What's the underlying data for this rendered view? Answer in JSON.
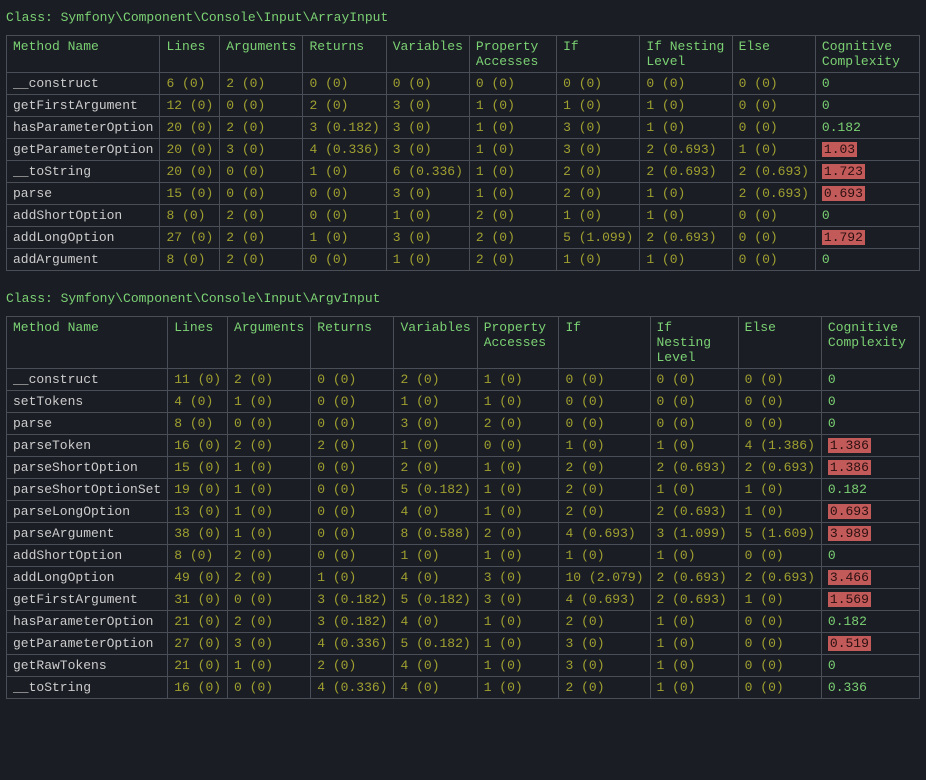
{
  "columns": [
    "Method Name",
    "Lines",
    "Arguments",
    "Returns",
    "Variables",
    "Property Accesses",
    "If",
    "If Nesting Level",
    "Else",
    "Cognitive Complexity"
  ],
  "tables": [
    {
      "title_prefix": "Class: ",
      "title_class": "Symfony\\Component\\Console\\Input\\ArrayInput",
      "rows": [
        {
          "name": "__construct",
          "lines": "6 (0)",
          "args": "2 (0)",
          "ret": "0 (0)",
          "vars": "0 (0)",
          "prop": "0 (0)",
          "if": "0 (0)",
          "nest": "0 (0)",
          "else": "0 (0)",
          "cc": "0",
          "cc_hl": false,
          "cc_green": true
        },
        {
          "name": "getFirstArgument",
          "lines": "12 (0)",
          "args": "0 (0)",
          "ret": "2 (0)",
          "vars": "3 (0)",
          "prop": "1 (0)",
          "if": "1 (0)",
          "nest": "1 (0)",
          "else": "0 (0)",
          "cc": "0",
          "cc_hl": false,
          "cc_green": true
        },
        {
          "name": "hasParameterOption",
          "lines": "20 (0)",
          "args": "2 (0)",
          "ret": "3 (0.182)",
          "vars": "3 (0)",
          "prop": "1 (0)",
          "if": "3 (0)",
          "nest": "1 (0)",
          "else": "0 (0)",
          "cc": "0.182",
          "cc_hl": false,
          "cc_green": true
        },
        {
          "name": "getParameterOption",
          "lines": "20 (0)",
          "args": "3 (0)",
          "ret": "4 (0.336)",
          "vars": "3 (0)",
          "prop": "1 (0)",
          "if": "3 (0)",
          "nest": "2 (0.693)",
          "else": "1 (0)",
          "cc": "1.03",
          "cc_hl": true,
          "cc_green": false
        },
        {
          "name": "__toString",
          "lines": "20 (0)",
          "args": "0 (0)",
          "ret": "1 (0)",
          "vars": "6 (0.336)",
          "prop": "1 (0)",
          "if": "2 (0)",
          "nest": "2 (0.693)",
          "else": "2 (0.693)",
          "cc": "1.723",
          "cc_hl": true,
          "cc_green": false
        },
        {
          "name": "parse",
          "lines": "15 (0)",
          "args": "0 (0)",
          "ret": "0 (0)",
          "vars": "3 (0)",
          "prop": "1 (0)",
          "if": "2 (0)",
          "nest": "1 (0)",
          "else": "2 (0.693)",
          "cc": "0.693",
          "cc_hl": true,
          "cc_green": false
        },
        {
          "name": "addShortOption",
          "lines": "8 (0)",
          "args": "2 (0)",
          "ret": "0 (0)",
          "vars": "1 (0)",
          "prop": "2 (0)",
          "if": "1 (0)",
          "nest": "1 (0)",
          "else": "0 (0)",
          "cc": "0",
          "cc_hl": false,
          "cc_green": true
        },
        {
          "name": "addLongOption",
          "lines": "27 (0)",
          "args": "2 (0)",
          "ret": "1 (0)",
          "vars": "3 (0)",
          "prop": "2 (0)",
          "if": "5 (1.099)",
          "nest": "2 (0.693)",
          "else": "0 (0)",
          "cc": "1.792",
          "cc_hl": true,
          "cc_green": false
        },
        {
          "name": "addArgument",
          "lines": "8 (0)",
          "args": "2 (0)",
          "ret": "0 (0)",
          "vars": "1 (0)",
          "prop": "2 (0)",
          "if": "1 (0)",
          "nest": "1 (0)",
          "else": "0 (0)",
          "cc": "0",
          "cc_hl": false,
          "cc_green": true
        }
      ]
    },
    {
      "title_prefix": "Class: ",
      "title_class": "Symfony\\Component\\Console\\Input\\ArgvInput",
      "rows": [
        {
          "name": "__construct",
          "lines": "11 (0)",
          "args": "2 (0)",
          "ret": "0 (0)",
          "vars": "2 (0)",
          "prop": "1 (0)",
          "if": "0 (0)",
          "nest": "0 (0)",
          "else": "0 (0)",
          "cc": "0",
          "cc_hl": false,
          "cc_green": true
        },
        {
          "name": "setTokens",
          "lines": "4 (0)",
          "args": "1 (0)",
          "ret": "0 (0)",
          "vars": "1 (0)",
          "prop": "1 (0)",
          "if": "0 (0)",
          "nest": "0 (0)",
          "else": "0 (0)",
          "cc": "0",
          "cc_hl": false,
          "cc_green": true
        },
        {
          "name": "parse",
          "lines": "8 (0)",
          "args": "0 (0)",
          "ret": "0 (0)",
          "vars": "3 (0)",
          "prop": "2 (0)",
          "if": "0 (0)",
          "nest": "0 (0)",
          "else": "0 (0)",
          "cc": "0",
          "cc_hl": false,
          "cc_green": true
        },
        {
          "name": "parseToken",
          "lines": "16 (0)",
          "args": "2 (0)",
          "ret": "2 (0)",
          "vars": "1 (0)",
          "prop": "0 (0)",
          "if": "1 (0)",
          "nest": "1 (0)",
          "else": "4 (1.386)",
          "cc": "1.386",
          "cc_hl": true,
          "cc_green": false
        },
        {
          "name": "parseShortOption",
          "lines": "15 (0)",
          "args": "1 (0)",
          "ret": "0 (0)",
          "vars": "2 (0)",
          "prop": "1 (0)",
          "if": "2 (0)",
          "nest": "2 (0.693)",
          "else": "2 (0.693)",
          "cc": "1.386",
          "cc_hl": true,
          "cc_green": false
        },
        {
          "name": "parseShortOptionSet",
          "lines": "19 (0)",
          "args": "1 (0)",
          "ret": "0 (0)",
          "vars": "5 (0.182)",
          "prop": "1 (0)",
          "if": "2 (0)",
          "nest": "1 (0)",
          "else": "1 (0)",
          "cc": "0.182",
          "cc_hl": false,
          "cc_green": true
        },
        {
          "name": "parseLongOption",
          "lines": "13 (0)",
          "args": "1 (0)",
          "ret": "0 (0)",
          "vars": "4 (0)",
          "prop": "1 (0)",
          "if": "2 (0)",
          "nest": "2 (0.693)",
          "else": "1 (0)",
          "cc": "0.693",
          "cc_hl": true,
          "cc_green": false
        },
        {
          "name": "parseArgument",
          "lines": "38 (0)",
          "args": "1 (0)",
          "ret": "0 (0)",
          "vars": "8 (0.588)",
          "prop": "2 (0)",
          "if": "4 (0.693)",
          "nest": "3 (1.099)",
          "else": "5 (1.609)",
          "cc": "3.989",
          "cc_hl": true,
          "cc_green": false
        },
        {
          "name": "addShortOption",
          "lines": "8 (0)",
          "args": "2 (0)",
          "ret": "0 (0)",
          "vars": "1 (0)",
          "prop": "1 (0)",
          "if": "1 (0)",
          "nest": "1 (0)",
          "else": "0 (0)",
          "cc": "0",
          "cc_hl": false,
          "cc_green": true
        },
        {
          "name": "addLongOption",
          "lines": "49 (0)",
          "args": "2 (0)",
          "ret": "1 (0)",
          "vars": "4 (0)",
          "prop": "3 (0)",
          "if": "10 (2.079)",
          "nest": "2 (0.693)",
          "else": "2 (0.693)",
          "cc": "3.466",
          "cc_hl": true,
          "cc_green": false
        },
        {
          "name": "getFirstArgument",
          "lines": "31 (0)",
          "args": "0 (0)",
          "ret": "3 (0.182)",
          "vars": "5 (0.182)",
          "prop": "3 (0)",
          "if": "4 (0.693)",
          "nest": "2 (0.693)",
          "else": "1 (0)",
          "cc": "1.569",
          "cc_hl": true,
          "cc_green": false
        },
        {
          "name": "hasParameterOption",
          "lines": "21 (0)",
          "args": "2 (0)",
          "ret": "3 (0.182)",
          "vars": "4 (0)",
          "prop": "1 (0)",
          "if": "2 (0)",
          "nest": "1 (0)",
          "else": "0 (0)",
          "cc": "0.182",
          "cc_hl": false,
          "cc_green": true
        },
        {
          "name": "getParameterOption",
          "lines": "27 (0)",
          "args": "3 (0)",
          "ret": "4 (0.336)",
          "vars": "5 (0.182)",
          "prop": "1 (0)",
          "if": "3 (0)",
          "nest": "1 (0)",
          "else": "0 (0)",
          "cc": "0.519",
          "cc_hl": true,
          "cc_green": false
        },
        {
          "name": "getRawTokens",
          "lines": "21 (0)",
          "args": "1 (0)",
          "ret": "2 (0)",
          "vars": "4 (0)",
          "prop": "1 (0)",
          "if": "3 (0)",
          "nest": "1 (0)",
          "else": "0 (0)",
          "cc": "0",
          "cc_hl": false,
          "cc_green": true
        },
        {
          "name": "__toString",
          "lines": "16 (0)",
          "args": "0 (0)",
          "ret": "4 (0.336)",
          "vars": "4 (0)",
          "prop": "1 (0)",
          "if": "2 (0)",
          "nest": "1 (0)",
          "else": "0 (0)",
          "cc": "0.336",
          "cc_hl": false,
          "cc_green": true
        }
      ]
    }
  ]
}
